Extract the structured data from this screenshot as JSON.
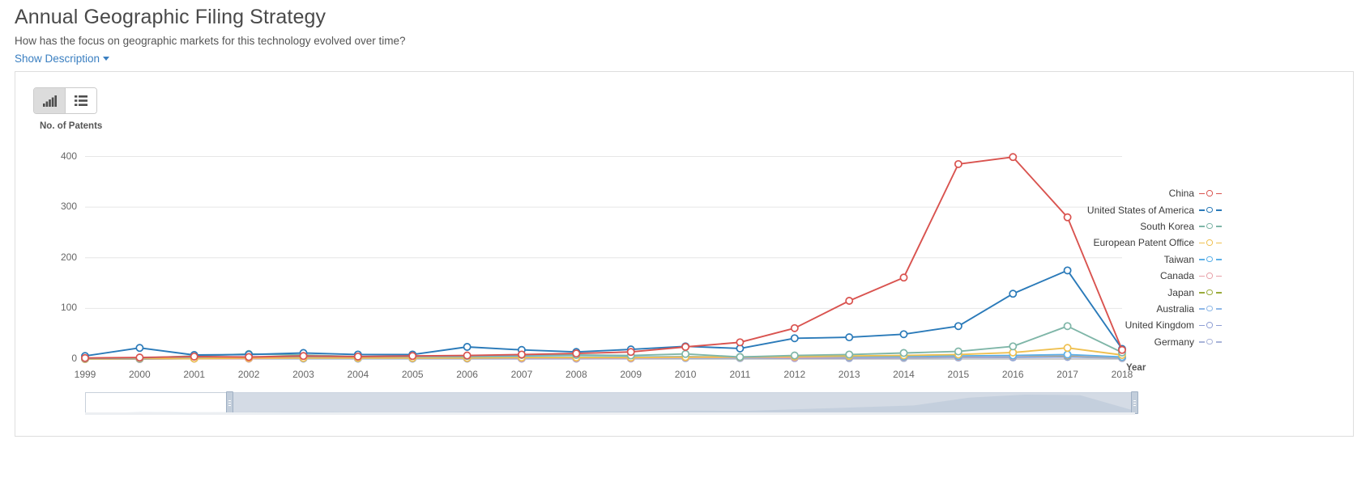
{
  "header": {
    "title": "Annual Geographic Filing Strategy",
    "subtitle": "How has the focus on geographic markets for this technology evolved over time?",
    "show_description": "Show Description"
  },
  "toolbar": {
    "chart_view_icon": "bar-chart-icon",
    "table_view_icon": "list-view-icon",
    "active_view": "chart"
  },
  "chart_data": {
    "type": "line",
    "title": "",
    "xlabel": "Year",
    "ylabel": "No. of Patents",
    "ylim": [
      0,
      420
    ],
    "yticks": [
      0,
      100,
      200,
      300,
      400
    ],
    "grid": true,
    "legend_position": "right",
    "categories": [
      1999,
      2000,
      2001,
      2002,
      2003,
      2004,
      2005,
      2006,
      2007,
      2008,
      2009,
      2010,
      2011,
      2012,
      2013,
      2014,
      2015,
      2016,
      2017,
      2018
    ],
    "series": [
      {
        "name": "China",
        "color": "#d9534f",
        "values": [
          2,
          3,
          5,
          4,
          6,
          5,
          6,
          7,
          9,
          11,
          14,
          24,
          33,
          61,
          115,
          161,
          385,
          399,
          280,
          18
        ]
      },
      {
        "name": "United States of America",
        "color": "#2a7ab9",
        "values": [
          6,
          22,
          8,
          9,
          12,
          9,
          9,
          24,
          18,
          14,
          19,
          25,
          21,
          41,
          43,
          49,
          65,
          129,
          175,
          20
        ]
      },
      {
        "name": "South Korea",
        "color": "#7fb6a8",
        "values": [
          1,
          2,
          6,
          10,
          8,
          5,
          6,
          6,
          8,
          8,
          7,
          10,
          4,
          7,
          9,
          12,
          15,
          25,
          65,
          13
        ]
      },
      {
        "name": "European Patent Office",
        "color": "#efc050",
        "values": [
          0,
          1,
          1,
          2,
          2,
          2,
          2,
          2,
          3,
          3,
          3,
          4,
          4,
          5,
          6,
          7,
          9,
          13,
          22,
          8
        ]
      },
      {
        "name": "Taiwan",
        "color": "#5bb0e8",
        "values": [
          1,
          1,
          3,
          4,
          5,
          4,
          4,
          5,
          5,
          4,
          4,
          5,
          4,
          5,
          5,
          5,
          6,
          7,
          9,
          4
        ]
      },
      {
        "name": "Canada",
        "color": "#e8a0a8",
        "values": [
          0,
          1,
          1,
          1,
          2,
          2,
          2,
          2,
          2,
          2,
          2,
          3,
          3,
          3,
          4,
          4,
          5,
          6,
          8,
          3
        ]
      },
      {
        "name": "Japan",
        "color": "#9aab3a",
        "values": [
          1,
          1,
          2,
          2,
          3,
          2,
          3,
          3,
          3,
          3,
          3,
          3,
          3,
          4,
          4,
          4,
          5,
          6,
          7,
          3
        ]
      },
      {
        "name": "Australia",
        "color": "#8fb8e8",
        "values": [
          0,
          1,
          1,
          1,
          1,
          1,
          1,
          2,
          2,
          2,
          2,
          2,
          2,
          3,
          3,
          3,
          4,
          5,
          6,
          2
        ]
      },
      {
        "name": "United Kingdom",
        "color": "#8e9ed4",
        "values": [
          0,
          0,
          1,
          1,
          1,
          1,
          1,
          1,
          1,
          1,
          2,
          2,
          2,
          2,
          2,
          3,
          3,
          4,
          5,
          2
        ]
      },
      {
        "name": "Germany",
        "color": "#a9b4d9",
        "values": [
          0,
          0,
          1,
          1,
          1,
          1,
          1,
          1,
          1,
          1,
          1,
          2,
          2,
          2,
          2,
          2,
          3,
          3,
          4,
          2
        ]
      }
    ]
  },
  "range_slider": {
    "handle_left": "range-handle-left",
    "handle_right": "range-handle-right"
  }
}
